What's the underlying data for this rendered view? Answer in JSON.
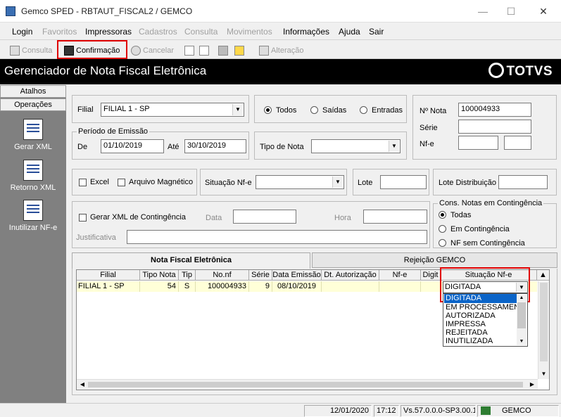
{
  "window": {
    "title": "Gemco SPED - RBTAUT_FISCAL2 / GEMCO",
    "minimize": "—",
    "maximize": "☐",
    "close": "✕"
  },
  "menu": [
    "Login",
    "Favoritos",
    "Impressoras",
    "Cadastros",
    "Consulta",
    "Movimentos",
    "Informações",
    "Ajuda",
    "Sair"
  ],
  "toolbar": {
    "consulta": "Consulta",
    "confirmacao": "Confirmação",
    "cancelar": "Cancelar",
    "alteracao": "Alteração"
  },
  "header": {
    "title": "Gerenciador de Nota Fiscal Eletrônica",
    "logo": "TOTVS"
  },
  "sidebar": {
    "tab_atalhos": "Atalhos",
    "tab_operacoes": "Operações",
    "items": [
      "Gerar XML",
      "Retorno XML",
      "Inutilizar NF-e"
    ]
  },
  "filters": {
    "filial_label": "Filial",
    "filial_value": "FILIAL 1 - SP",
    "periodo_label": "Período de Emissão",
    "de_label": "De",
    "de_value": "01/10/2019",
    "ate_label": "Até",
    "ate_value": "30/10/2019",
    "radio_todos": "Todos",
    "radio_saidas": "Saídas",
    "radio_entradas": "Entradas",
    "tipo_nota_label": "Tipo de Nota",
    "tipo_nota_value": "",
    "nota_label": "Nº Nota",
    "nota_value": "100004933",
    "serie_label": "Série",
    "serie_value": "",
    "nfe_label": "Nf-e",
    "nfe_value1": "",
    "nfe_value2": "",
    "excel_label": "Excel",
    "arquivo_label": "Arquivo Magnético",
    "situacao_label": "Situação Nf-e",
    "situacao_value": "",
    "lote_label": "Lote",
    "lote_value": "",
    "lote_dist_label": "Lote Distribuição",
    "lote_dist_value": "",
    "gerar_cont_label": "Gerar XML de Contingência",
    "data_label": "Data",
    "data_value": "",
    "hora_label": "Hora",
    "hora_value": "",
    "justificativa_label": "Justificativa",
    "justificativa_value": "",
    "cons_label": "Cons. Notas em Contingência",
    "cons_todas": "Todas",
    "cons_em": "Em Contingência",
    "cons_sem": "NF sem Contingência"
  },
  "tabs": {
    "nfe": "Nota Fiscal Eletrônica",
    "rejeicao": "Rejeição GEMCO"
  },
  "grid": {
    "columns": [
      "Filial",
      "Tipo Nota",
      "Tip",
      "No.nf",
      "Série",
      "Data Emissão",
      "Dt. Autorização",
      "Nf-e",
      "Digit",
      "Situação Nf-e"
    ],
    "rows": [
      {
        "filial": "FILIAL 1 - SP",
        "tipo_nota": "54",
        "tip": "S",
        "nonf": "100004933",
        "serie": "9",
        "data_emissao": "08/10/2019",
        "dt_autorizacao": "",
        "nfe": "",
        "digit": "",
        "situacao": "DIGITADA"
      }
    ],
    "dropdown_options": [
      "DIGITADA",
      "EM PROCESSAMENTO",
      "AUTORIZADA",
      "IMPRESSA",
      "REJEITADA",
      "INUTILIZADA"
    ],
    "dropdown_selected": "DIGITADA"
  },
  "status": {
    "date": "12/01/2020",
    "time": "17:12",
    "version": "Vs.57.0.0.0-SP3.00.1",
    "company": "GEMCO"
  },
  "colors": {
    "highlight_box": "#e00000",
    "header_bg": "#000000",
    "row_bg": "#ffffd8",
    "selected_item": "#0a64c8"
  }
}
